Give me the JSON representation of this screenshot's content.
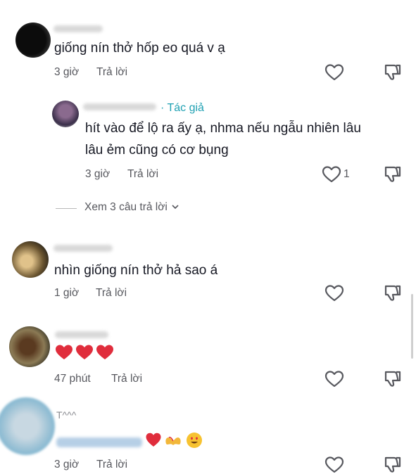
{
  "comments": [
    {
      "text": "giống nín thở hốp eo quá v ạ",
      "time": "3 giờ",
      "reply_label": "Trả lời",
      "reply": {
        "author_tag": "· Tác giả",
        "text_line1": "hít vào để lộ ra ấy ạ, nhma nếu ngẫu nhiên lâu",
        "text_line2": "lâu ẻm cũng có cơ bụng",
        "time": "3 giờ",
        "reply_label": "Trả lời",
        "like_count": "1"
      },
      "view_replies": "Xem 3 câu trả lời"
    },
    {
      "text": "nhìn giống nín thở hả sao á",
      "time": "1 giờ",
      "reply_label": "Trả lời"
    },
    {
      "emoji_text": "❤️❤️❤️",
      "time": "47 phút",
      "reply_label": "Trả lời"
    },
    {
      "name_partial": "T^^^",
      "time": "3 giờ",
      "reply_label": "Trả lời"
    }
  ],
  "icons": {
    "like": "heart-outline-icon",
    "dislike": "thumbs-down-icon",
    "chevron": "chevron-down-icon"
  },
  "colors": {
    "author_tag": "#20a1b3",
    "meta_text": "#57585e",
    "primary_text": "#161823",
    "heart_red": "#e02d3c"
  }
}
